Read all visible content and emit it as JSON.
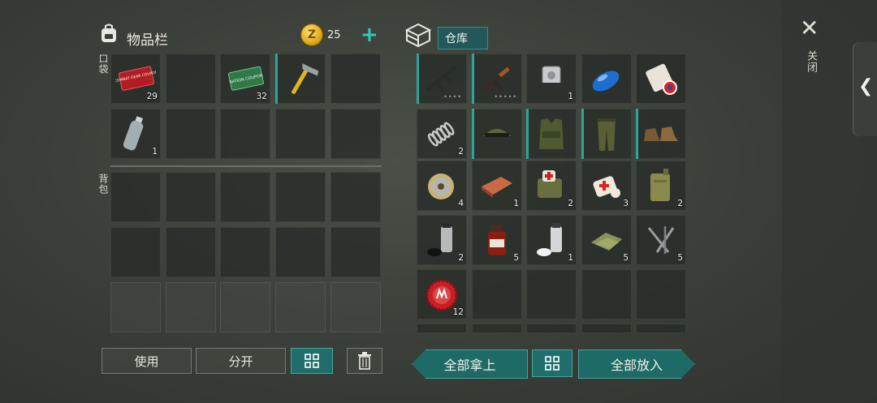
{
  "inventory": {
    "title": "物品栏",
    "coins": "25",
    "coin_symbol": "Z",
    "add_symbol": "+",
    "pocket_label": "口袋",
    "backpack_label": "背包",
    "pocket_slots": [
      {
        "icon": "combat-gear-coupon-icon",
        "count": "29"
      },
      {
        "icon": "empty",
        "count": ""
      },
      {
        "icon": "ration-coupon-icon",
        "count": "32"
      },
      {
        "icon": "hammer-icon",
        "count": ""
      },
      {
        "icon": "empty",
        "count": ""
      },
      {
        "icon": "water-bottle-icon",
        "count": "1"
      }
    ]
  },
  "coupon_text": {
    "combat": "COMBAT GEAR COUPON",
    "ration": "RATION COUPON"
  },
  "warehouse": {
    "title": "仓库",
    "slots": [
      {
        "icon": "m16-rifle-icon",
        "count": "",
        "dots": "••••"
      },
      {
        "icon": "ak-rifle-icon",
        "count": "",
        "dots": "•••••"
      },
      {
        "icon": "engine-part-icon",
        "count": "1"
      },
      {
        "icon": "fuel-tank-icon",
        "count": ""
      },
      {
        "icon": "paper-roll-icon",
        "count": ""
      },
      {
        "icon": "spring-icon",
        "count": "2"
      },
      {
        "icon": "cap-glasses-icon",
        "count": ""
      },
      {
        "icon": "camo-vest-icon",
        "count": ""
      },
      {
        "icon": "camo-pants-icon",
        "count": ""
      },
      {
        "icon": "boots-icon",
        "count": ""
      },
      {
        "icon": "wire-spool-icon",
        "count": "4"
      },
      {
        "icon": "copper-ingot-icon",
        "count": "1"
      },
      {
        "icon": "medkit-bag-icon",
        "count": "2"
      },
      {
        "icon": "bandage-icon",
        "count": "3"
      },
      {
        "icon": "jerrycan-icon",
        "count": "2"
      },
      {
        "icon": "spray-paint-icon",
        "count": "2"
      },
      {
        "icon": "medicine-bottle-icon",
        "count": "5"
      },
      {
        "icon": "spray-can-white-icon",
        "count": "1"
      },
      {
        "icon": "cloth-icon",
        "count": "5"
      },
      {
        "icon": "nails-icon",
        "count": "5"
      },
      {
        "icon": "bottle-cap-icon",
        "count": "12"
      }
    ]
  },
  "buttons": {
    "use": "使用",
    "split": "分开",
    "take_all": "全部拿上",
    "put_all": "全部放入"
  },
  "close_label": "关闭",
  "close_symbol": "✕",
  "side_tab_symbol": "❮"
}
